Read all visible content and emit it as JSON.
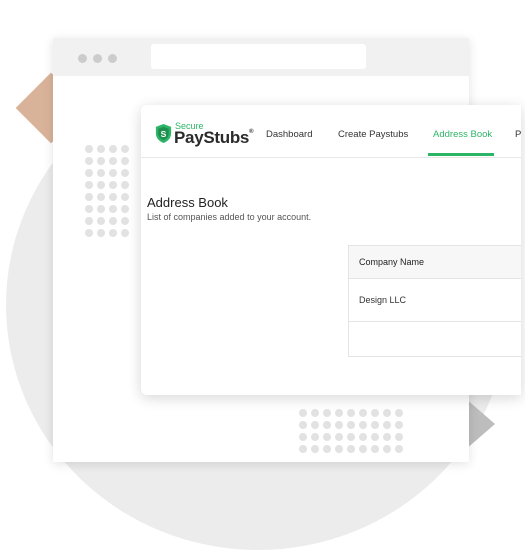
{
  "logo": {
    "secure": "Secure",
    "brand": "PayStubs",
    "reg": "®"
  },
  "nav": {
    "items": [
      {
        "label": "Dashboard"
      },
      {
        "label": "Create Paystubs"
      },
      {
        "label": "Address Book"
      },
      {
        "label": "P"
      }
    ],
    "active": "Address Book",
    "accent_color": "#2db567"
  },
  "page": {
    "title": "Address Book",
    "subtitle": "List of companies added to your account."
  },
  "table": {
    "header": "Company Name",
    "rows": [
      {
        "company": "Design LLC"
      },
      {
        "company": ""
      }
    ]
  }
}
